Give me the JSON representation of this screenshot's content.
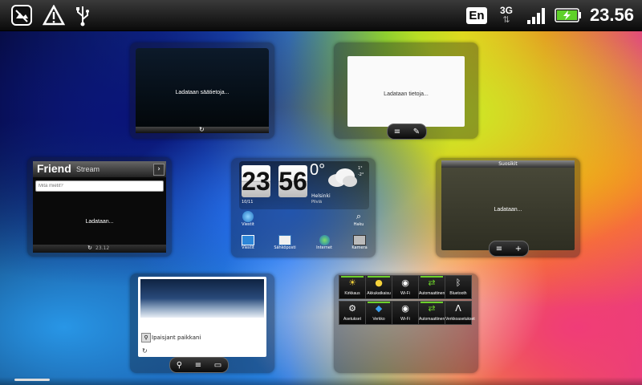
{
  "status": {
    "language": "En",
    "network": "3G",
    "time": "23.56"
  },
  "weather_widget": {
    "hour": "23",
    "minute": "56",
    "temperature": "0°",
    "hi": "1°",
    "lo": "-2°",
    "city": "Helsinki",
    "condition": "Pilviä",
    "date": "10/11"
  },
  "weather_panel": {
    "loading": "Ladataan säätietoja..."
  },
  "notes_panel": {
    "loading": "Ladataan tietoja..."
  },
  "friend_stream": {
    "title_bold": "Friend",
    "title_light": "Stream",
    "placeholder": "Mitä mietit?",
    "loading": "Ladataan...",
    "timestamp": "23.12"
  },
  "subscribe_panel": {
    "title": "Suosikit",
    "loading": "Ladataan..."
  },
  "shortcuts": [
    {
      "icon": "phone-icon",
      "label": "Viestit"
    },
    {
      "icon": "search-icon",
      "label": "Haku"
    },
    {
      "icon": "chat-icon",
      "label": "Viestit"
    },
    {
      "icon": "mail-icon",
      "label": "Sähköposti"
    },
    {
      "icon": "globe-icon",
      "label": "Internet"
    },
    {
      "icon": "camera-icon",
      "label": "Kamera"
    }
  ],
  "map_panel": {
    "caption": "Ipaisjant paikkani"
  },
  "settings": {
    "row1": [
      "Kirkkaus",
      "Akkukatkaisu",
      "Wi-Fi",
      "Automaattinen",
      "Bluetooth"
    ],
    "row2": [
      "Asetukset",
      "Verkko",
      "Wi-Fi",
      "Automaattinen",
      "Verkkoasetukset"
    ]
  },
  "colors": {
    "accent_green": "#6ccf2a",
    "battery_green": "#5fd12a",
    "statusbar": "#111111"
  }
}
